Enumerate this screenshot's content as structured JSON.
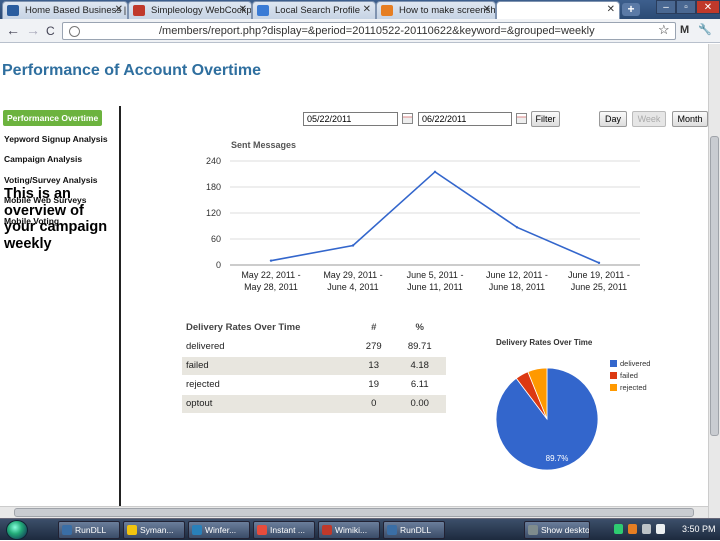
{
  "browser": {
    "tabs": [
      {
        "label": "Home Based Business |",
        "favicon_color": "#2a5d9f"
      },
      {
        "label": "Simpleology WebCockp",
        "favicon_color": "#c0392b"
      },
      {
        "label": "Local Search Profile",
        "favicon_color": "#3a7bd5"
      },
      {
        "label": "How to make screensho",
        "favicon_color": "#e67e22"
      },
      {
        "label": "",
        "favicon_color": "#ffffff"
      }
    ],
    "new_tab_symbol": "+",
    "window_buttons": {
      "minimize": "–",
      "maximize": "▫",
      "close": "✕"
    },
    "url": "/members/report.php?display=&period=20110522-20110622&keyword=&grouped=weekly",
    "nav": {
      "back": "←",
      "forward": "→",
      "reload": "C"
    },
    "toolbar_icons": {
      "star": "☆",
      "mail": "M",
      "wrench": "🔧"
    }
  },
  "page": {
    "title": "Performance of Account Overtime",
    "sidebar": [
      {
        "label": "Performance Overtime",
        "active": true
      },
      {
        "label": "Yepword Signup Analysis",
        "active": false
      },
      {
        "label": "Campaign Analysis",
        "active": false
      },
      {
        "label": "Voting/Survey Analysis",
        "active": false
      },
      {
        "label": "Mobile Web Surveys",
        "active": false
      },
      {
        "label": "Mobile Voting",
        "active": false
      }
    ],
    "overview_text": "This is an overview of your campaign weekly",
    "filter": {
      "start_date": "05/22/2011",
      "end_date": "06/22/2011",
      "filter_label": "Filter",
      "day_label": "Day",
      "week_label": "Week",
      "month_label": "Month"
    },
    "sent_title": "Sent Messages",
    "table": {
      "headers": [
        "Delivery Rates Over Time",
        "#",
        "%"
      ],
      "rows": [
        [
          "delivered",
          "279",
          "89.71"
        ],
        [
          "failed",
          "13",
          "4.18"
        ],
        [
          "rejected",
          "19",
          "6.11"
        ],
        [
          "optout",
          "0",
          "0.00"
        ]
      ]
    },
    "pie_title": "Delivery Rates Over Time"
  },
  "chart_data": [
    {
      "type": "line",
      "title": "Sent Messages",
      "categories": [
        [
          "May 22, 2011 -",
          "May 28, 2011"
        ],
        [
          "May 29, 2011 -",
          "June 4, 2011"
        ],
        [
          "June 5, 2011 -",
          "June 11, 2011"
        ],
        [
          "June 12, 2011 -",
          "June 18, 2011"
        ],
        [
          "June 19, 2011 -",
          "June 25, 2011"
        ]
      ],
      "series": [
        {
          "values": [
            10,
            45,
            215,
            87,
            5
          ]
        }
      ],
      "yticks": [
        0,
        60,
        120,
        180,
        240
      ],
      "ylim": [
        0,
        240
      ],
      "grid": true,
      "color": "#3366cc"
    },
    {
      "type": "pie",
      "title": "Delivery Rates Over Time",
      "slices": [
        {
          "name": "delivered",
          "value": 89.71,
          "color": "#3366cc"
        },
        {
          "name": "failed",
          "value": 4.18,
          "color": "#dc3912"
        },
        {
          "name": "rejected",
          "value": 6.11,
          "color": "#ff9900"
        }
      ],
      "slice_label": "89.7%",
      "legend": "right"
    }
  ],
  "taskbar": {
    "tasks": [
      {
        "label": "RunDLL",
        "color": "#3a6ea5"
      },
      {
        "label": "Syman...",
        "color": "#f1c40f"
      },
      {
        "label": "Winfer...",
        "color": "#2980b9"
      },
      {
        "label": "Instant ...",
        "color": "#e74c3c"
      },
      {
        "label": "Wimiki...",
        "color": "#c0392b"
      },
      {
        "label": "RunDLL",
        "color": "#3a6ea5"
      },
      {
        "label": "Show desktop",
        "color": "#7f8c8d"
      }
    ],
    "clock": "3:50 PM"
  }
}
